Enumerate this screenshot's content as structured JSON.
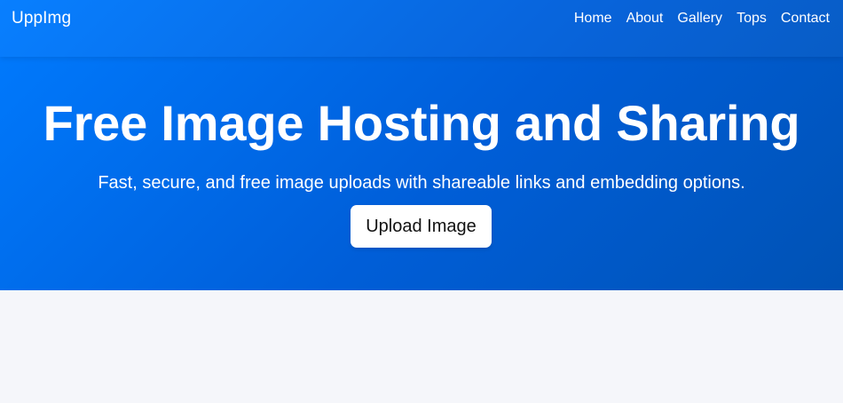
{
  "navbar": {
    "brand": "UppImg",
    "links": [
      "Home",
      "About",
      "Gallery",
      "Tops",
      "Contact"
    ]
  },
  "hero": {
    "title": "Free Image Hosting and Sharing",
    "subtitle": "Fast, secure, and free image uploads with shareable links and embedding options.",
    "button_label": "Upload Image"
  },
  "colors": {
    "hero_gradient_start": "#007bff",
    "hero_gradient_end": "#0052b4",
    "page_background": "#f5f6fa",
    "button_background": "#ffffff"
  }
}
